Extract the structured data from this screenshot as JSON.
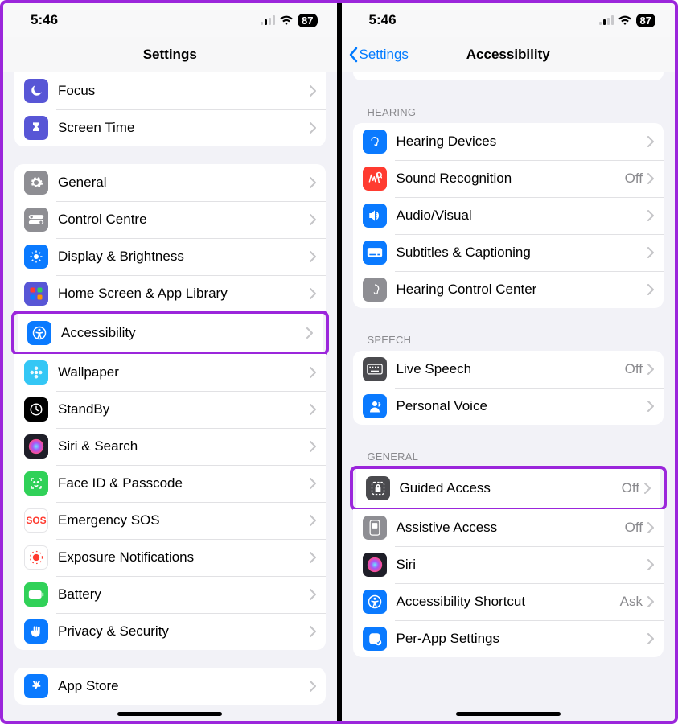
{
  "status": {
    "time": "5:46",
    "battery": "87"
  },
  "left": {
    "title": "Settings",
    "group1": [
      {
        "label": "Focus",
        "iconColor": "#5856d6",
        "icon": "moon"
      },
      {
        "label": "Screen Time",
        "iconColor": "#5856d6",
        "icon": "hourglass"
      }
    ],
    "group2": [
      {
        "label": "General",
        "iconColor": "#8e8e93",
        "icon": "gear"
      },
      {
        "label": "Control Centre",
        "iconColor": "#8e8e93",
        "icon": "toggles"
      },
      {
        "label": "Display & Brightness",
        "iconColor": "#0a7aff",
        "icon": "sun"
      },
      {
        "label": "Home Screen & App Library",
        "iconColor": "#5856d6",
        "icon": "grid"
      },
      {
        "label": "Accessibility",
        "iconColor": "#0a7aff",
        "icon": "accessibility",
        "highlight": true
      },
      {
        "label": "Wallpaper",
        "iconColor": "#34c7f5",
        "icon": "flower"
      },
      {
        "label": "StandBy",
        "iconColor": "#000000",
        "icon": "clock"
      },
      {
        "label": "Siri & Search",
        "iconColor": "#1e1e28",
        "icon": "siri"
      },
      {
        "label": "Face ID & Passcode",
        "iconColor": "#30d158",
        "icon": "face"
      },
      {
        "label": "Emergency SOS",
        "iconColor": "#ffffff",
        "icon": "sos",
        "textColor": "#ff3b30"
      },
      {
        "label": "Exposure Notifications",
        "iconColor": "#ffffff",
        "icon": "exposure",
        "textColor": "#ff3b30"
      },
      {
        "label": "Battery",
        "iconColor": "#30d158",
        "icon": "battery"
      },
      {
        "label": "Privacy & Security",
        "iconColor": "#0a7aff",
        "icon": "hand"
      }
    ],
    "group3": [
      {
        "label": "App Store",
        "iconColor": "#0a7aff",
        "icon": "appstore"
      }
    ]
  },
  "right": {
    "back": "Settings",
    "title": "Accessibility",
    "sections": {
      "hearing": {
        "header": "Hearing",
        "rows": [
          {
            "label": "Hearing Devices",
            "iconColor": "#0a7aff",
            "icon": "ear"
          },
          {
            "label": "Sound Recognition",
            "iconColor": "#ff3b30",
            "icon": "sound",
            "detail": "Off"
          },
          {
            "label": "Audio/Visual",
            "iconColor": "#0a7aff",
            "icon": "speaker"
          },
          {
            "label": "Subtitles & Captioning",
            "iconColor": "#0a7aff",
            "icon": "cc"
          },
          {
            "label": "Hearing Control Center",
            "iconColor": "#8e8e93",
            "icon": "earcc"
          }
        ]
      },
      "speech": {
        "header": "Speech",
        "rows": [
          {
            "label": "Live Speech",
            "iconColor": "#4a4a4e",
            "icon": "keyboard",
            "detail": "Off"
          },
          {
            "label": "Personal Voice",
            "iconColor": "#0a7aff",
            "icon": "person"
          }
        ]
      },
      "general": {
        "header": "General",
        "rows": [
          {
            "label": "Guided Access",
            "iconColor": "#4a4a4e",
            "icon": "guided",
            "detail": "Off",
            "highlight": true
          },
          {
            "label": "Assistive Access",
            "iconColor": "#8e8e93",
            "icon": "assistive",
            "detail": "Off"
          },
          {
            "label": "Siri",
            "iconColor": "#1e1e28",
            "icon": "siri"
          },
          {
            "label": "Accessibility Shortcut",
            "iconColor": "#0a7aff",
            "icon": "shortcut",
            "detail": "Ask"
          },
          {
            "label": "Per-App Settings",
            "iconColor": "#0a7aff",
            "icon": "perapp"
          }
        ]
      }
    }
  }
}
